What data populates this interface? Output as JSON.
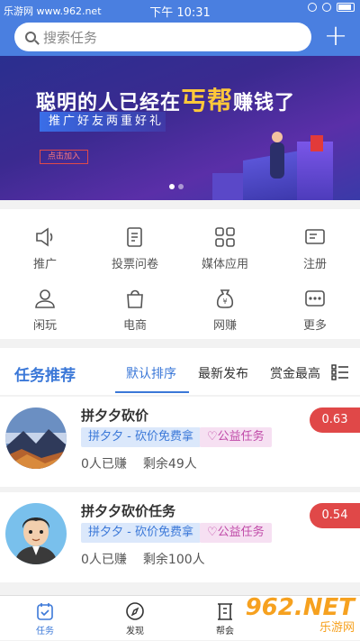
{
  "status_bar": {
    "watermark_text": "乐游网 www.962.net",
    "time": "下午 10:31"
  },
  "search": {
    "placeholder": "搜索任务"
  },
  "banner": {
    "headline_prefix": "聪明的人已经在",
    "headline_highlight": "丐帮",
    "headline_suffix": "赚钱了",
    "promo": "推广好友两重好礼",
    "join_button": "点击加入"
  },
  "categories": [
    {
      "label": "推广",
      "icon": "speaker-icon"
    },
    {
      "label": "投票问卷",
      "icon": "clipboard-icon"
    },
    {
      "label": "媒体应用",
      "icon": "grid-icon"
    },
    {
      "label": "注册",
      "icon": "register-card-icon"
    },
    {
      "label": "闲玩",
      "icon": "person-icon"
    },
    {
      "label": "电商",
      "icon": "shopping-bag-icon"
    },
    {
      "label": "网赚",
      "icon": "money-bag-icon"
    },
    {
      "label": "更多",
      "icon": "more-dots-icon"
    }
  ],
  "tasks_section": {
    "title": "任务推荐",
    "tabs": [
      "默认排序",
      "最新发布",
      "赏金最高"
    ],
    "active_tab": 0
  },
  "tasks": [
    {
      "name": "拼夕夕砍价",
      "tag1": "拼夕夕 - 砍价免费拿",
      "tag2": "♡公益任务",
      "earned": "0人已赚",
      "remaining": "剩余49人",
      "price": "0.63"
    },
    {
      "name": "拼夕夕砍价任务",
      "tag1": "拼夕夕 - 砍价免费拿",
      "tag2": "♡公益任务",
      "earned": "0人已赚",
      "remaining": "剩余100人",
      "price": "0.54"
    }
  ],
  "bottom_nav": [
    {
      "label": "任务",
      "icon": "task-icon"
    },
    {
      "label": "发现",
      "icon": "compass-icon"
    },
    {
      "label": "帮会",
      "icon": "guild-icon"
    }
  ],
  "corner_watermark": {
    "big": "962.NET",
    "small": "乐游网"
  },
  "colors": {
    "primary": "#4a7fe0",
    "accent_blue": "#3b78d8",
    "price_red": "#e04848",
    "highlight_yellow": "#ffc83a"
  }
}
